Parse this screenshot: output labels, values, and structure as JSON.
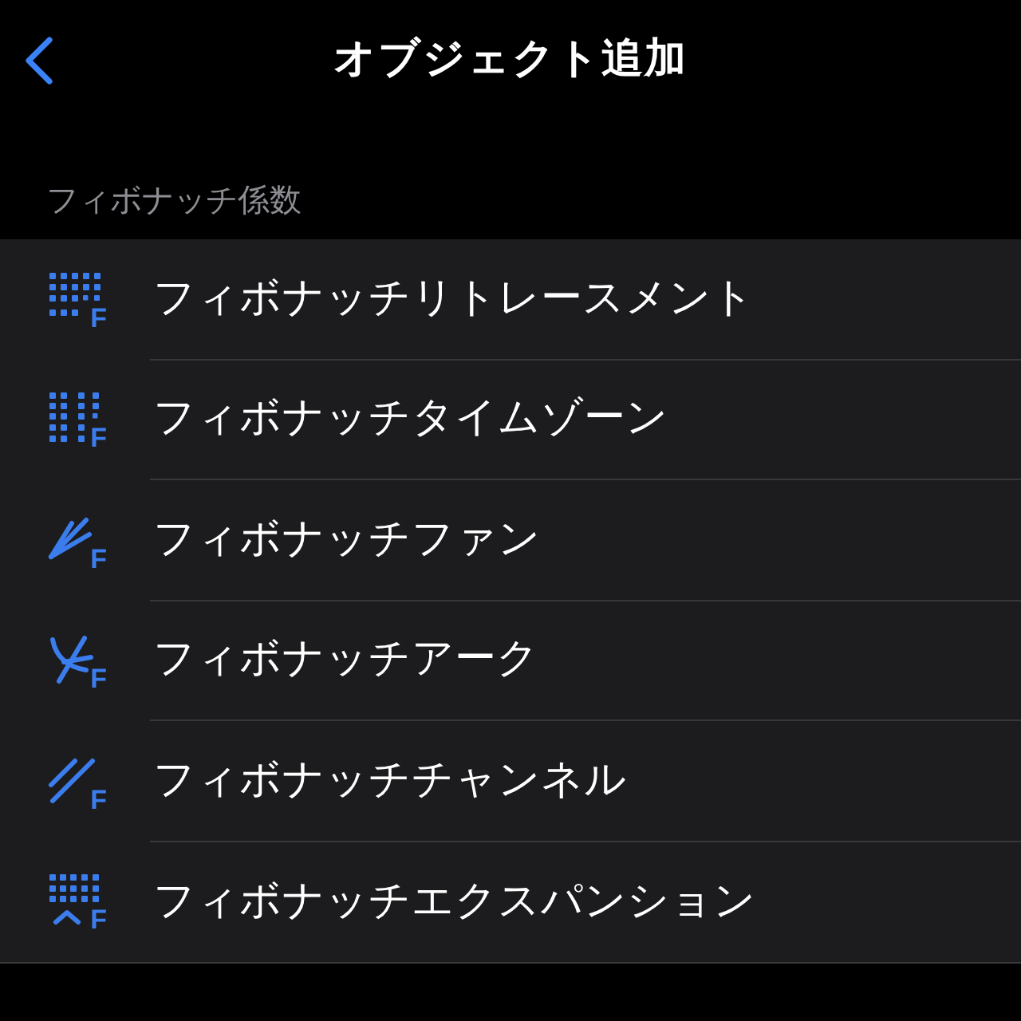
{
  "nav": {
    "title": "オブジェクト追加"
  },
  "section": {
    "header": "フィボナッチ係数",
    "items": [
      {
        "label": "フィボナッチリトレースメント",
        "icon_letter": "F"
      },
      {
        "label": "フィボナッチタイムゾーン",
        "icon_letter": "F"
      },
      {
        "label": "フィボナッチファン",
        "icon_letter": "F"
      },
      {
        "label": "フィボナッチアーク",
        "icon_letter": "F"
      },
      {
        "label": "フィボナッチチャンネル",
        "icon_letter": "F"
      },
      {
        "label": "フィボナッチエクスパンション",
        "icon_letter": "F"
      }
    ]
  }
}
